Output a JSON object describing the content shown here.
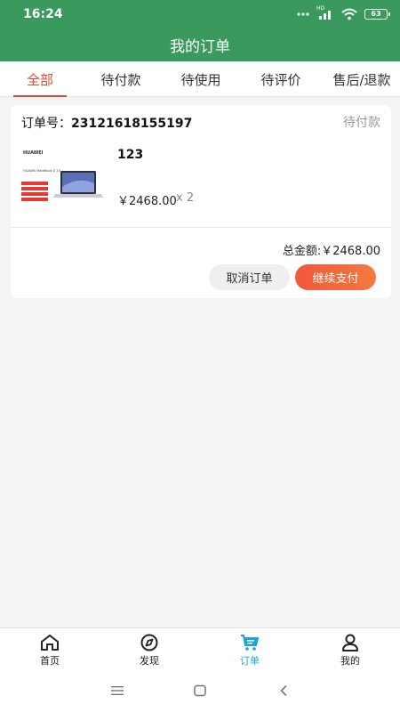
{
  "status_bar": {
    "time": "16:24",
    "network": "HD",
    "battery": "63"
  },
  "header": {
    "title": "我的订单"
  },
  "tabs": [
    {
      "label": "全部",
      "active": true
    },
    {
      "label": "待付款",
      "active": false
    },
    {
      "label": "待使用",
      "active": false
    },
    {
      "label": "待评价",
      "active": false
    },
    {
      "label": "售后/退款",
      "active": false
    }
  ],
  "order": {
    "number_label": "订单号：",
    "number": "23121618155197",
    "status": "待付款",
    "product": {
      "thumbnail_brand": "HUAWEI",
      "thumbnail_model": "HUAWEI MateBook D 15",
      "title": "123",
      "price": "￥2468.00",
      "quantity": "x 2"
    },
    "total_label": "总金额:",
    "total": "￥2468.00",
    "cancel_label": "取消订单",
    "pay_label": "继续支付"
  },
  "bottom_nav": [
    {
      "label": "首页",
      "icon": "home-icon",
      "active": false
    },
    {
      "label": "发现",
      "icon": "compass-icon",
      "active": false
    },
    {
      "label": "订单",
      "icon": "cart-icon",
      "active": true
    },
    {
      "label": "我的",
      "icon": "user-icon",
      "active": false
    }
  ],
  "colors": {
    "header_green": "#3a9a5e",
    "accent_red": "#e0483a",
    "active_nav_blue": "#1aa3d6"
  }
}
